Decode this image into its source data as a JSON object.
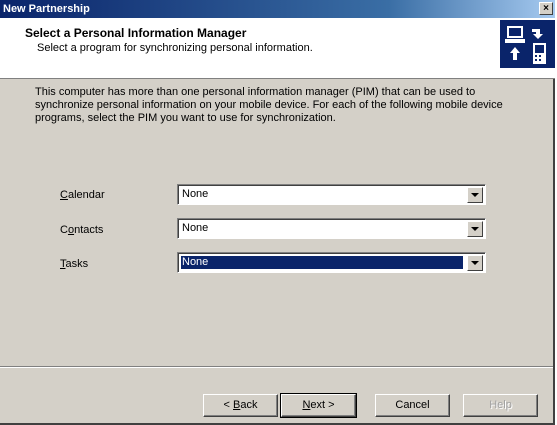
{
  "window": {
    "title": "New Partnership",
    "close_glyph": "×"
  },
  "header": {
    "title": "Select a Personal Information Manager",
    "subtitle": "Select a program for synchronizing personal information.",
    "icon": "sync-devices-icon"
  },
  "body": {
    "description": "This computer has more than one personal information manager (PIM) that can be used to synchronize personal information on your mobile device. For each of the following mobile device programs, select the PIM you want to use for synchronization.",
    "rows": [
      {
        "label_key": "C",
        "label_rest": "alendar",
        "value": "None"
      },
      {
        "label_key": "",
        "label_prefix": "C",
        "label_key2": "o",
        "label_rest": "ntacts",
        "value": "None"
      },
      {
        "label_key": "T",
        "label_rest": "asks",
        "value": "None"
      }
    ]
  },
  "buttons": {
    "back_prefix": "< ",
    "back_key": "B",
    "back_rest": "ack",
    "next_key": "N",
    "next_rest": "ext >",
    "cancel": "Cancel",
    "help": "Help"
  }
}
